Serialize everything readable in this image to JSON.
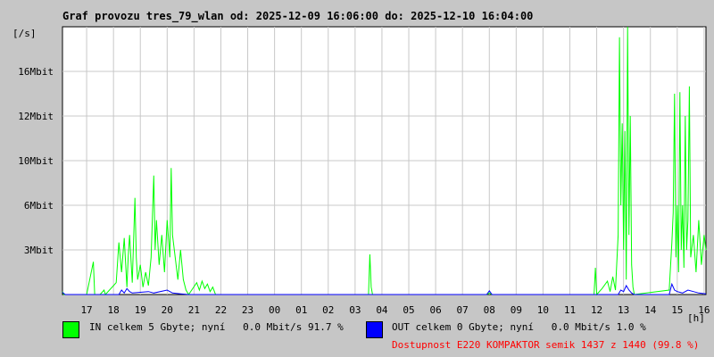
{
  "title": "Graf provozu tres_79_wlan od: 2025-12-09 16:06:00 do: 2025-12-10 16:04:00",
  "chart_data": {
    "type": "line",
    "ylabel": "[/s]",
    "xlabel": "[h]",
    "y_ticks": [
      {
        "label": "3Mbit",
        "value": 3
      },
      {
        "label": "6Mbit",
        "value": 6
      },
      {
        "label": "10Mbit",
        "value": 9
      },
      {
        "label": "12Mbit",
        "value": 12
      },
      {
        "label": "16Mbit",
        "value": 15
      }
    ],
    "x_ticks": [
      "17",
      "18",
      "19",
      "20",
      "21",
      "22",
      "23",
      "00",
      "01",
      "02",
      "03",
      "04",
      "05",
      "06",
      "07",
      "08",
      "09",
      "10",
      "11",
      "12",
      "13",
      "14",
      "15",
      "16"
    ],
    "x_start_hour": 16.1,
    "x_end_hour": 40.07,
    "ylim": [
      0,
      18
    ],
    "grid": true,
    "series": [
      {
        "name": "IN",
        "color": "#00ff00",
        "points": [
          [
            16.1,
            0.2
          ],
          [
            16.15,
            0
          ],
          [
            17.0,
            0
          ],
          [
            17.25,
            2.2
          ],
          [
            17.3,
            0
          ],
          [
            17.5,
            0
          ],
          [
            17.65,
            0.3
          ],
          [
            17.7,
            0
          ],
          [
            18.1,
            0.8
          ],
          [
            18.2,
            3.5
          ],
          [
            18.3,
            1.5
          ],
          [
            18.4,
            3.8
          ],
          [
            18.5,
            0.5
          ],
          [
            18.55,
            2.6
          ],
          [
            18.6,
            4
          ],
          [
            18.7,
            0.8
          ],
          [
            18.8,
            6.5
          ],
          [
            18.85,
            2.5
          ],
          [
            18.9,
            1
          ],
          [
            19.0,
            2
          ],
          [
            19.1,
            0.5
          ],
          [
            19.2,
            1.5
          ],
          [
            19.3,
            0.6
          ],
          [
            19.4,
            2.5
          ],
          [
            19.5,
            8
          ],
          [
            19.55,
            3
          ],
          [
            19.6,
            5
          ],
          [
            19.7,
            2
          ],
          [
            19.8,
            4
          ],
          [
            19.9,
            1.5
          ],
          [
            20.0,
            5
          ],
          [
            20.1,
            2.5
          ],
          [
            20.15,
            8.5
          ],
          [
            20.2,
            4
          ],
          [
            20.3,
            2.5
          ],
          [
            20.4,
            1
          ],
          [
            20.5,
            3
          ],
          [
            20.6,
            1
          ],
          [
            20.7,
            0.3
          ],
          [
            20.8,
            0
          ],
          [
            21.1,
            0.8
          ],
          [
            21.2,
            0.3
          ],
          [
            21.3,
            0.9
          ],
          [
            21.4,
            0.4
          ],
          [
            21.5,
            0.7
          ],
          [
            21.6,
            0.2
          ],
          [
            21.7,
            0.5
          ],
          [
            21.8,
            0
          ],
          [
            27.5,
            0
          ],
          [
            27.55,
            2.7
          ],
          [
            27.6,
            0.5
          ],
          [
            27.65,
            0
          ],
          [
            31.9,
            0
          ],
          [
            32.0,
            0.1
          ],
          [
            32.1,
            0
          ],
          [
            35.9,
            0
          ],
          [
            35.95,
            1.8
          ],
          [
            36.0,
            0
          ],
          [
            36.2,
            0.4
          ],
          [
            36.4,
            0.9
          ],
          [
            36.5,
            0.2
          ],
          [
            36.6,
            1.2
          ],
          [
            36.7,
            0.3
          ],
          [
            36.8,
            4
          ],
          [
            36.85,
            17.3
          ],
          [
            36.9,
            6
          ],
          [
            36.95,
            11.5
          ],
          [
            37.0,
            3
          ],
          [
            37.05,
            11
          ],
          [
            37.1,
            1
          ],
          [
            37.15,
            18
          ],
          [
            37.2,
            4
          ],
          [
            37.25,
            12
          ],
          [
            37.3,
            2
          ],
          [
            37.35,
            0.5
          ],
          [
            37.4,
            0
          ],
          [
            38.7,
            0.3
          ],
          [
            38.8,
            3.5
          ],
          [
            38.85,
            5.5
          ],
          [
            38.9,
            13.5
          ],
          [
            38.95,
            2.5
          ],
          [
            39.0,
            6
          ],
          [
            39.05,
            1.5
          ],
          [
            39.1,
            13.6
          ],
          [
            39.15,
            3
          ],
          [
            39.2,
            6
          ],
          [
            39.25,
            1.8
          ],
          [
            39.3,
            12
          ],
          [
            39.35,
            3
          ],
          [
            39.4,
            5
          ],
          [
            39.45,
            14
          ],
          [
            39.5,
            2.5
          ],
          [
            39.6,
            4
          ],
          [
            39.7,
            1.5
          ],
          [
            39.8,
            5
          ],
          [
            39.9,
            2
          ],
          [
            40.0,
            4
          ],
          [
            40.07,
            3
          ]
        ]
      },
      {
        "name": "OUT",
        "color": "#0000ff",
        "points": [
          [
            16.1,
            0.15
          ],
          [
            16.2,
            0
          ],
          [
            18.2,
            0
          ],
          [
            18.3,
            0.3
          ],
          [
            18.4,
            0.1
          ],
          [
            18.5,
            0.4
          ],
          [
            18.6,
            0.2
          ],
          [
            18.7,
            0.1
          ],
          [
            19.3,
            0.2
          ],
          [
            19.5,
            0.1
          ],
          [
            20.0,
            0.3
          ],
          [
            20.2,
            0.1
          ],
          [
            20.5,
            0.05
          ],
          [
            20.8,
            0
          ],
          [
            31.9,
            0
          ],
          [
            32.0,
            0.25
          ],
          [
            32.1,
            0
          ],
          [
            36.8,
            0
          ],
          [
            36.9,
            0.3
          ],
          [
            37.0,
            0.2
          ],
          [
            37.1,
            0.6
          ],
          [
            37.2,
            0.3
          ],
          [
            37.3,
            0.1
          ],
          [
            37.4,
            0
          ],
          [
            38.7,
            0
          ],
          [
            38.8,
            0.7
          ],
          [
            38.9,
            0.3
          ],
          [
            39.0,
            0.2
          ],
          [
            39.2,
            0.1
          ],
          [
            39.4,
            0.3
          ],
          [
            39.6,
            0.2
          ],
          [
            39.8,
            0.1
          ],
          [
            40.07,
            0.05
          ]
        ]
      }
    ]
  },
  "legend": {
    "in_color": "#00ff00",
    "out_color": "#0000ff",
    "in_text": "IN celkem 5 Gbyte; nyní   0.0 Mbit/s 91.7 %",
    "out_text": "OUT celkem 0 Gbyte; nyní   0.0 Mbit/s 1.0 %",
    "availability": "Dostupnost E220 KOMPAKTOR semik 1437 z 1440 (99.8 %)"
  }
}
